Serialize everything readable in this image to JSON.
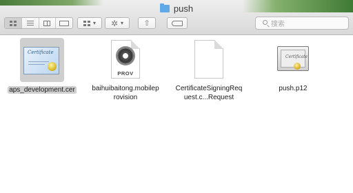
{
  "window": {
    "title": "push"
  },
  "toolbar": {
    "view_modes": [
      "icon",
      "list",
      "columns",
      "cover-flow"
    ],
    "active_view": "icon",
    "arrange_icon": "arrange-grid-icon",
    "action_icon": "gear-icon",
    "share_icon": "share-icon",
    "tag_icon": "tag-icon",
    "search_placeholder": "搜索"
  },
  "files": [
    {
      "name": "aps_development.cer",
      "type": "certificate",
      "selected": true
    },
    {
      "name": "baihuibaitong.mobileprovision",
      "type": "provisioning-profile",
      "badge": "PROV",
      "selected": false
    },
    {
      "name": "CertificateSigningRequest.c...Request",
      "type": "blank-document",
      "selected": false
    },
    {
      "name": "push.p12",
      "type": "p12-certificate",
      "selected": false
    }
  ],
  "colors": {
    "selection": "#cfcfcf",
    "folder": "#5fa9e8"
  }
}
